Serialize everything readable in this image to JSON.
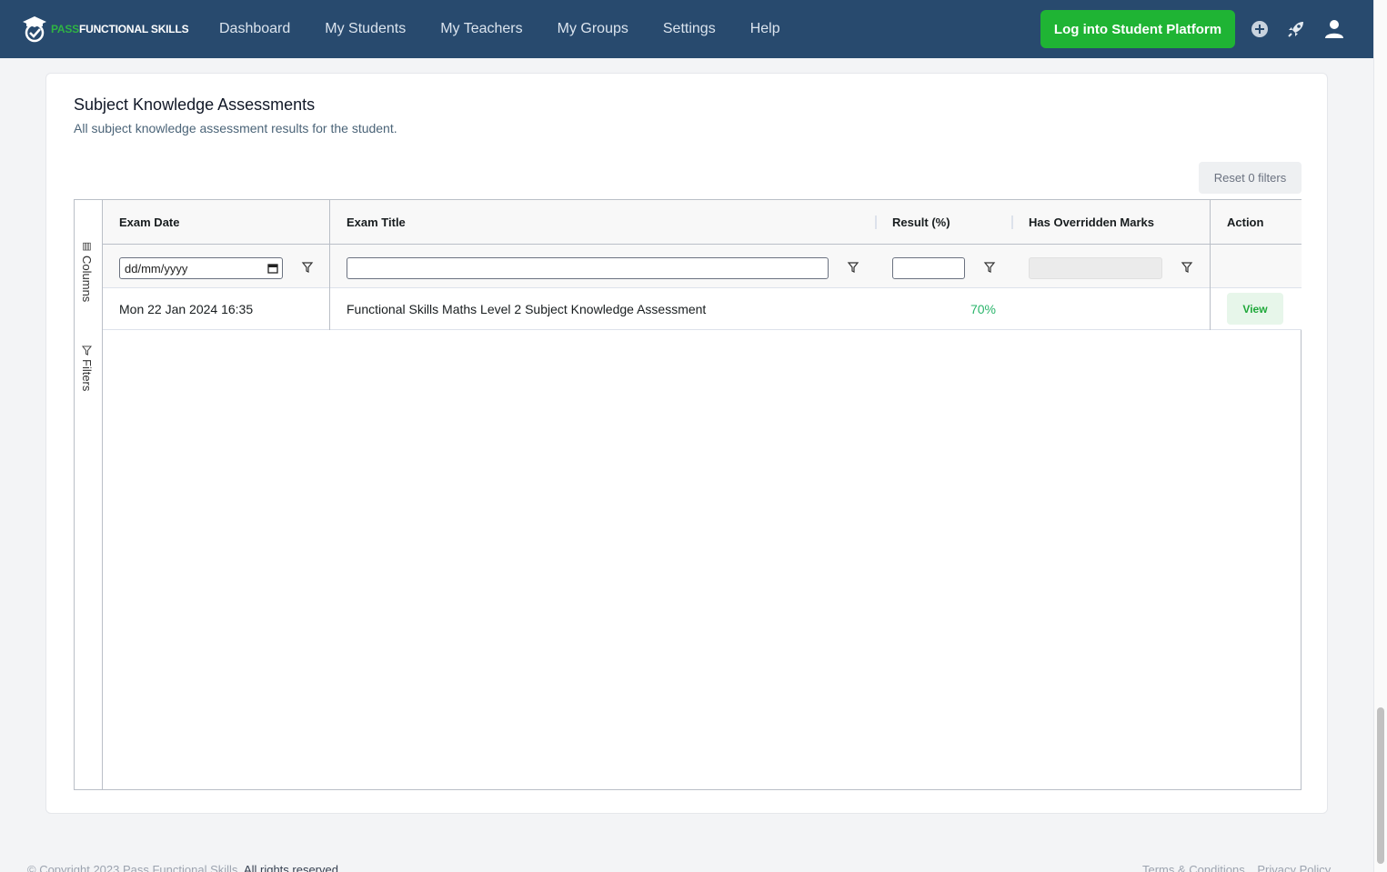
{
  "brand": {
    "pass": "PASS",
    "rest": "FUNCTIONAL SKILLS",
    "accent": "#2fb344",
    "nav_bg": "#284a6e"
  },
  "nav": {
    "links": [
      "Dashboard",
      "My Students",
      "My Teachers",
      "My Groups",
      "Settings",
      "Help"
    ],
    "login_button": "Log into Student Platform",
    "icons": [
      "plus-circle-icon",
      "rocket-icon",
      "user-icon"
    ]
  },
  "card": {
    "title": "Subject Knowledge Assessments",
    "subtitle": "All subject knowledge assessment results for the student.",
    "reset_button": "Reset 0 filters"
  },
  "grid": {
    "side_tabs": {
      "columns": "Columns",
      "filters": "Filters"
    },
    "columns": [
      "Exam Date",
      "Exam Title",
      "Result (%)",
      "Has Overridden Marks",
      "Action"
    ],
    "filters": {
      "date_placeholder": "dd/mm/yyyy",
      "title_value": "",
      "result_value": ""
    },
    "rows": [
      {
        "exam_date": "Mon 22 Jan 2024 16:35",
        "exam_title": "Functional Skills Maths Level 2 Subject Knowledge Assessment",
        "result": "70%",
        "overridden": "",
        "action": "View"
      }
    ]
  },
  "footer": {
    "copyright": "© Copyright 2023 Pass Functional Skills.",
    "rights": "All rights reserved.",
    "links": [
      "Terms & Conditions",
      "Privacy Policy"
    ]
  }
}
